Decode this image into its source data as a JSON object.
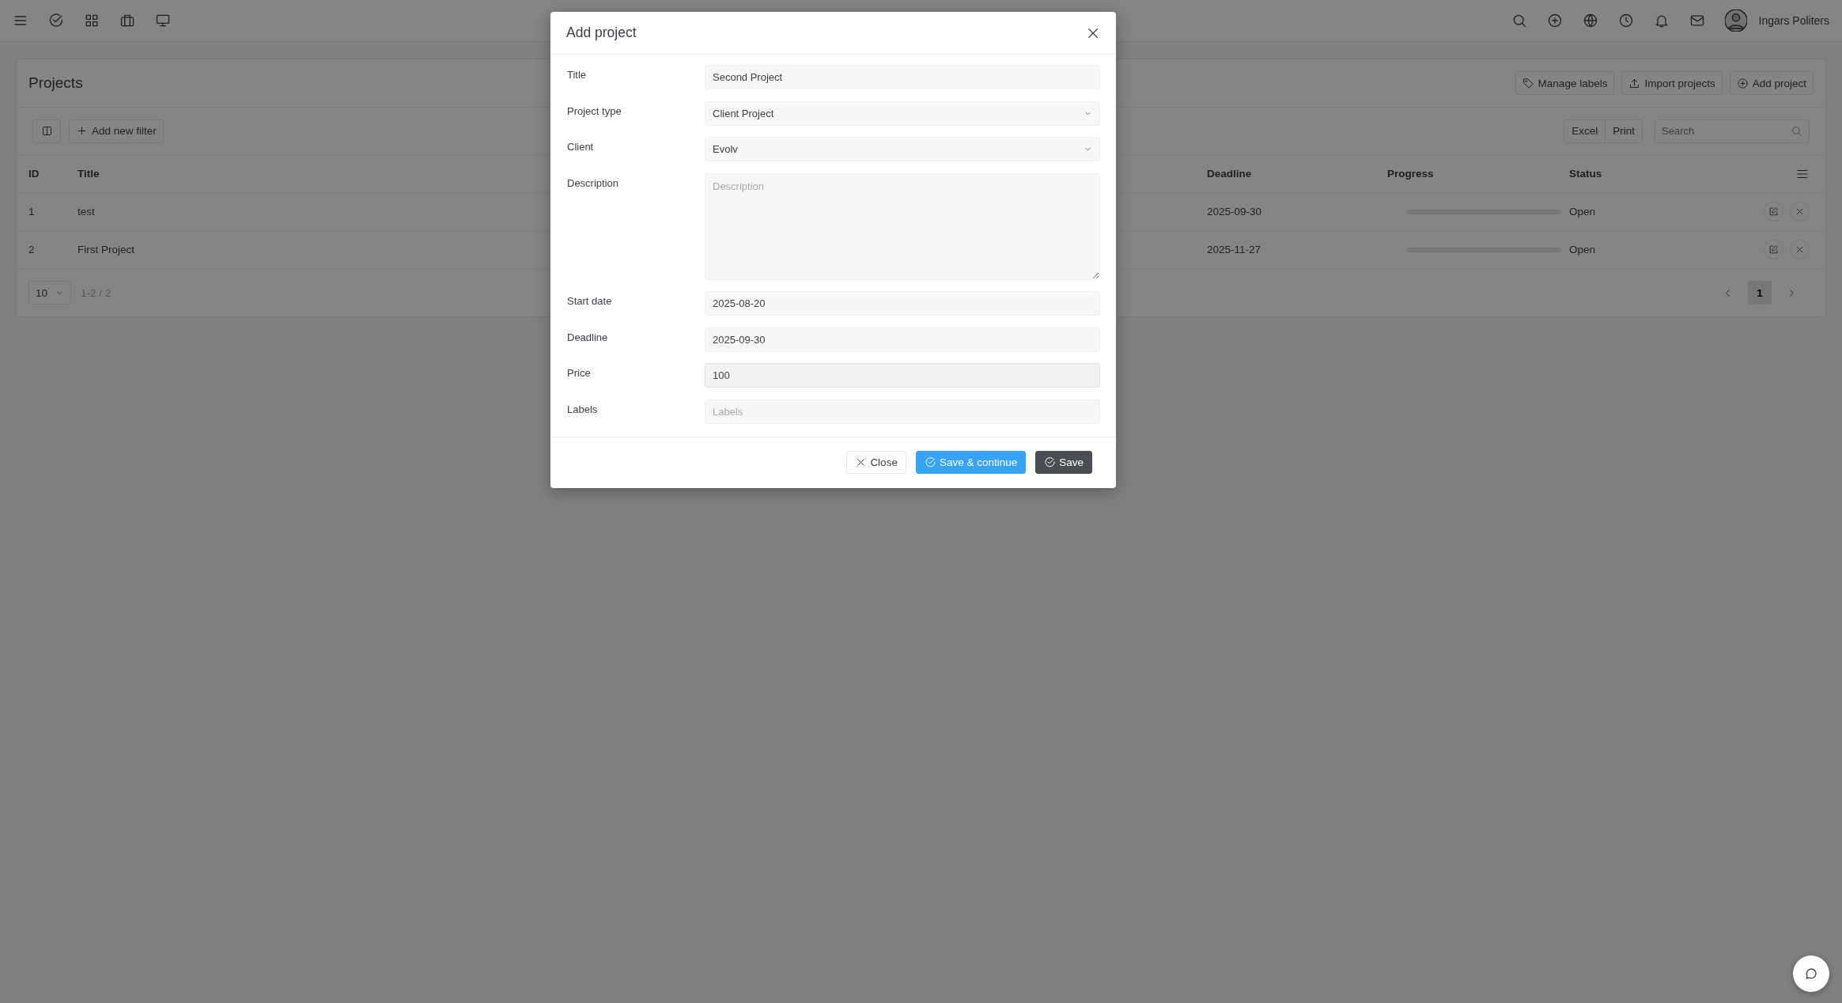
{
  "topbar": {
    "user_name": "Ingars Politers"
  },
  "page": {
    "title": "Projects",
    "manage_labels": "Manage labels",
    "import_projects": "Import projects",
    "add_project": "Add project"
  },
  "toolbar": {
    "add_filter": "Add new filter",
    "exports": [
      "Excel",
      "Print"
    ],
    "search": {
      "placeholder": "Search"
    }
  },
  "table": {
    "columns": [
      {
        "label": "ID"
      },
      {
        "label": "Title"
      },
      {
        "label": "Deadline"
      },
      {
        "label": "Progress"
      },
      {
        "label": "Status"
      }
    ],
    "rows": [
      {
        "id": "1",
        "title": "test",
        "deadline": "2025-09-30",
        "progress": {
          "level": 0
        },
        "status": "Open"
      },
      {
        "id": "2",
        "title": "First Project",
        "deadline": "2025-11-27",
        "progress": {
          "level": 0
        },
        "status": "Open"
      }
    ]
  },
  "pagination": {
    "page_size": "10",
    "range": "1-2 / 2",
    "pages": [
      {
        "label": "1",
        "selected": true
      }
    ]
  },
  "modal": {
    "title": "Add project",
    "fields": [
      {
        "label": "Title",
        "kind": "text",
        "value": "Second Project",
        "focused": false
      },
      {
        "label": "Project type",
        "kind": "select",
        "value": "Client Project",
        "focused": false
      },
      {
        "label": "Client",
        "kind": "select",
        "value": "Evolv",
        "focused": false
      },
      {
        "label": "Description",
        "kind": "textarea",
        "placeholder": "Description",
        "focused": false
      },
      {
        "label": "Start date",
        "kind": "text",
        "value": "2025-08-20",
        "focused": false
      },
      {
        "label": "Deadline",
        "kind": "text",
        "value": "2025-09-30",
        "focused": false
      },
      {
        "label": "Price",
        "kind": "text",
        "value": "100",
        "focused": true
      },
      {
        "label": "Labels",
        "kind": "text",
        "placeholder": "Labels",
        "focused": false
      }
    ],
    "close": "Close",
    "save_continue": "Save & continue",
    "save": "Save"
  }
}
